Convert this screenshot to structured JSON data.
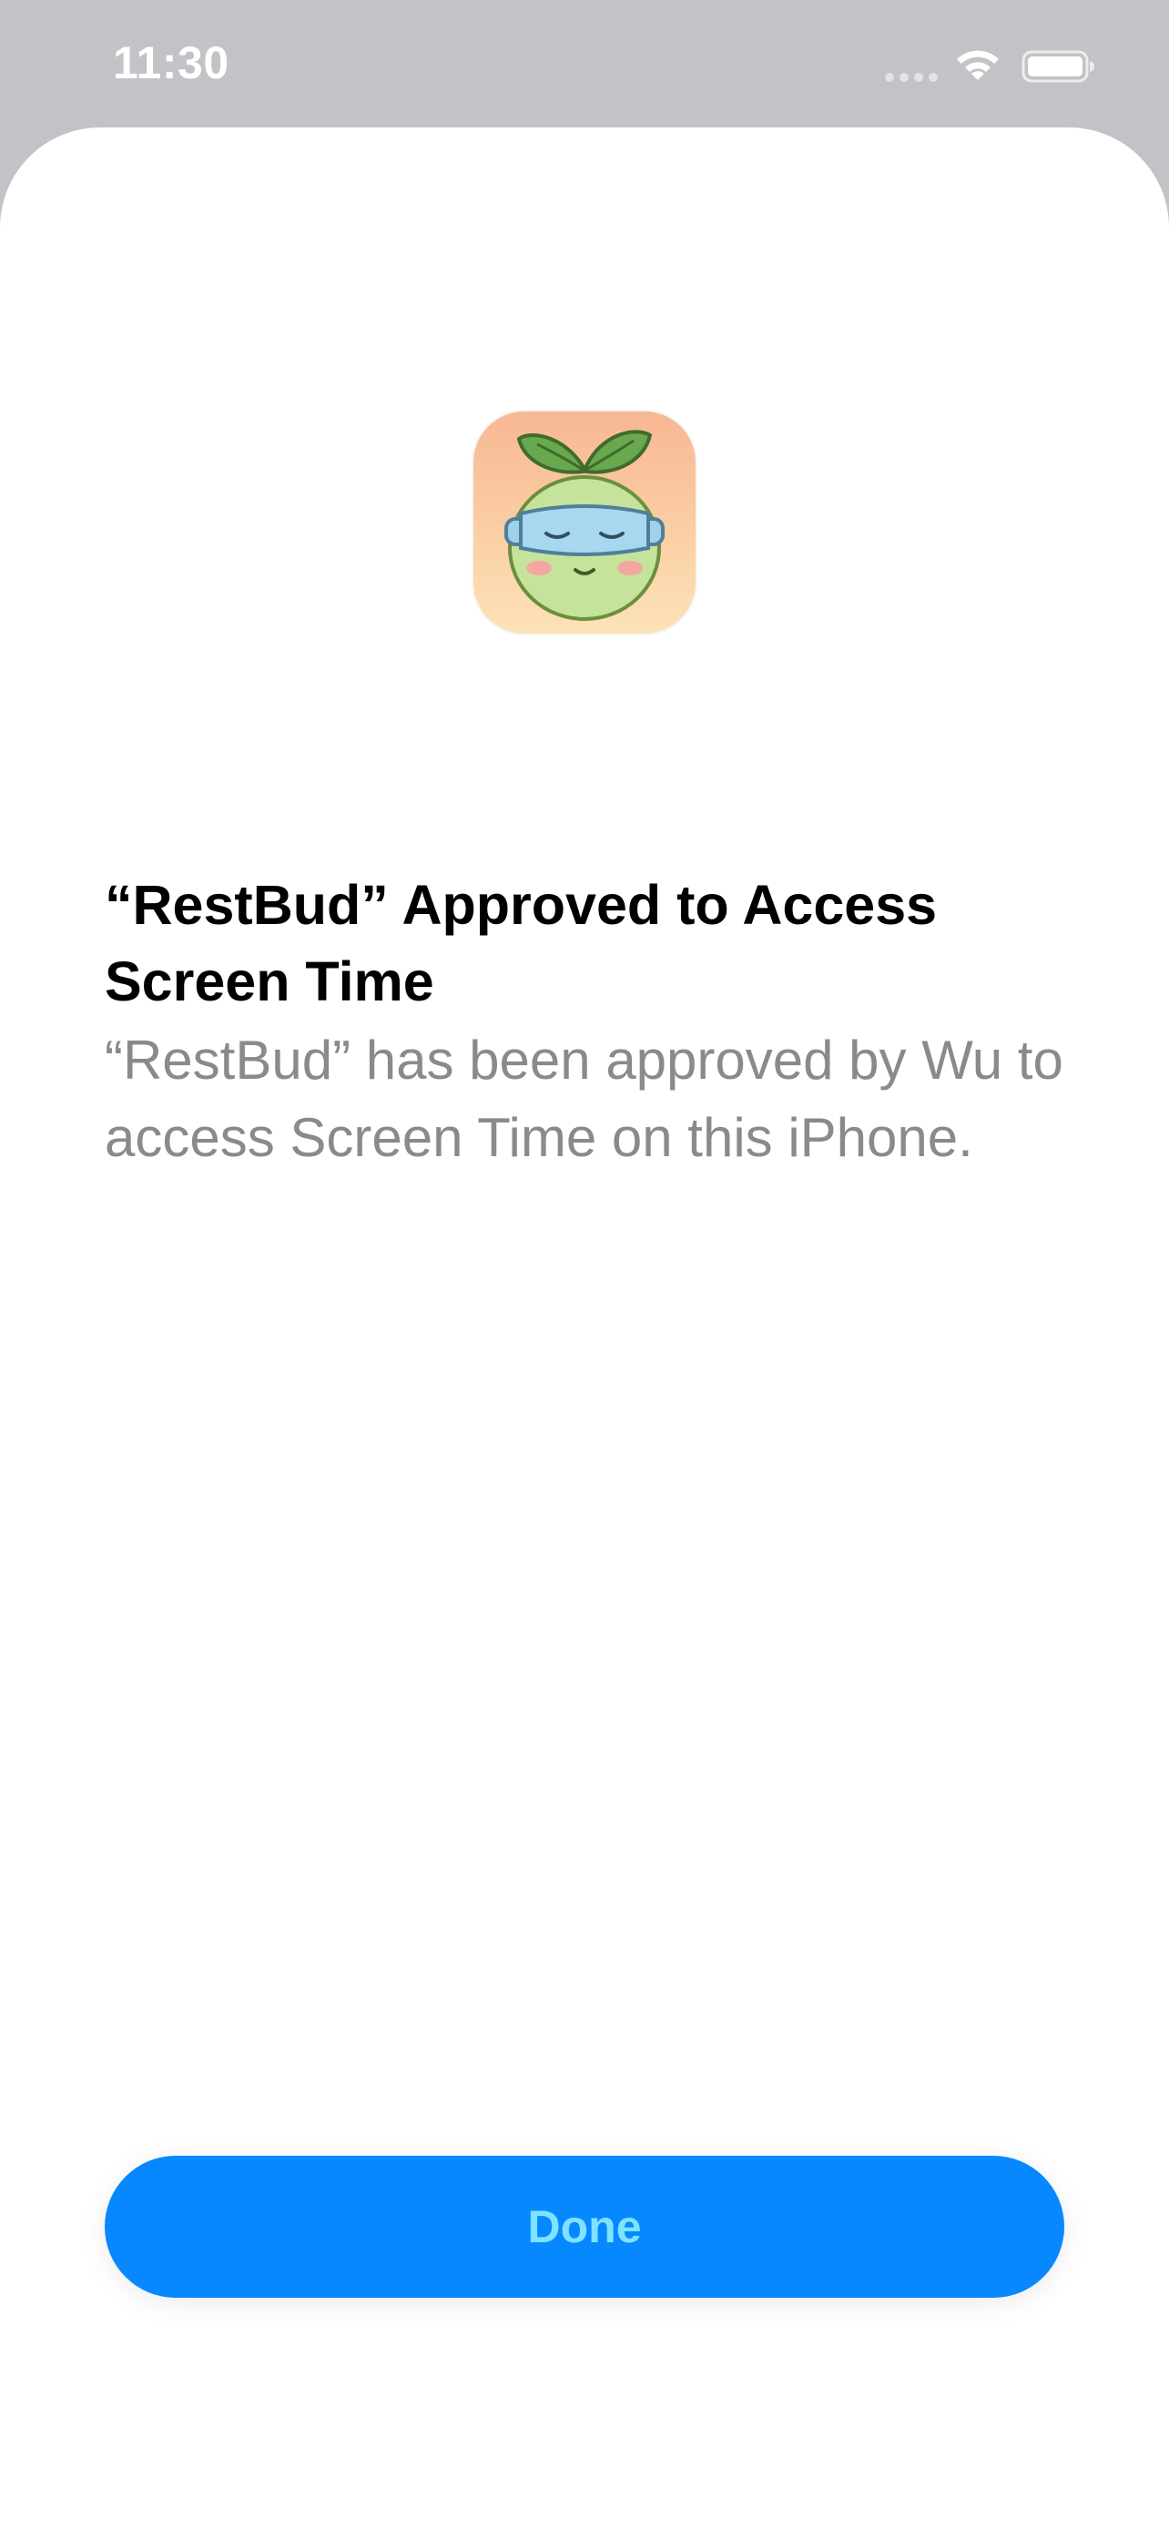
{
  "status_bar": {
    "time": "11:30",
    "icons": [
      "cellular-signal-icon",
      "wifi-icon",
      "battery-icon"
    ]
  },
  "sheet": {
    "app_icon": "restbud-app-icon",
    "title": "“RestBud” Approved to Access Screen Time",
    "subtitle": "“RestBud” has been approved by Wu to access Screen Time on this iPhone.",
    "done_label": "Done"
  },
  "colors": {
    "background_dim": "#c2c2c7",
    "sheet": "#ffffff",
    "button": "#0788ff",
    "button_text": "#7ee3ff",
    "subtitle_text": "#8a8a8e"
  }
}
